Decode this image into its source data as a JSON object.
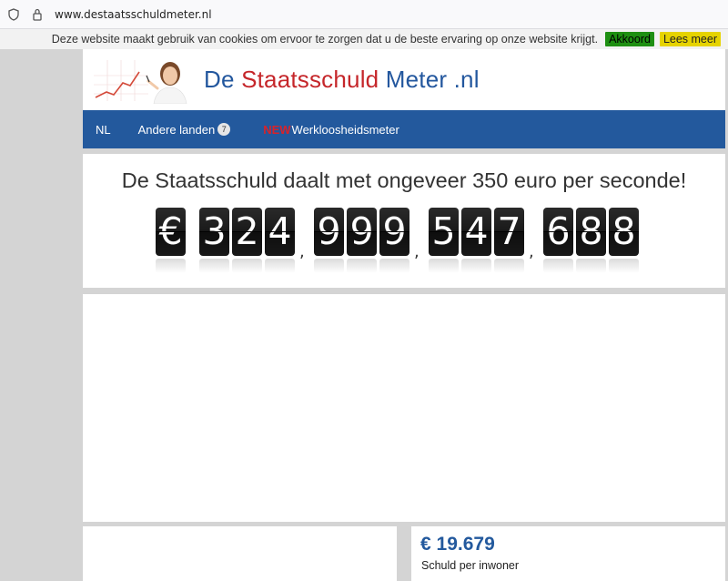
{
  "browser": {
    "url": "www.destaatsschuldmeter.nl"
  },
  "cookie_bar": {
    "message": "Deze website maakt gebruik van cookies om ervoor te zorgen dat u de beste ervaring op onze website krijgt.",
    "accept_label": "Akkoord",
    "more_label": "Lees meer"
  },
  "logo": {
    "part1": "De ",
    "part2": "Staatsschuld",
    "part3": " Meter .nl"
  },
  "nav": {
    "nl": "NL",
    "other_countries": "Andere landen",
    "other_countries_count": "7",
    "new_tag": "NEW",
    "unemployment": "Werkloosheidsmeter"
  },
  "debt": {
    "headline": "De Staatsschuld daalt met ongeveer 350 euro per seconde!",
    "currency_symbol": "€",
    "digit_groups": [
      "324",
      "999",
      "547",
      "688"
    ],
    "separator": ","
  },
  "stats": {
    "per_capita_value": "€ 19.679",
    "per_capita_label": "Schuld per inwoner"
  },
  "colors": {
    "nav_blue": "#23599d",
    "logo_red": "#c5262a",
    "accept_green": "#1e8f12",
    "more_yellow": "#e6d300"
  }
}
